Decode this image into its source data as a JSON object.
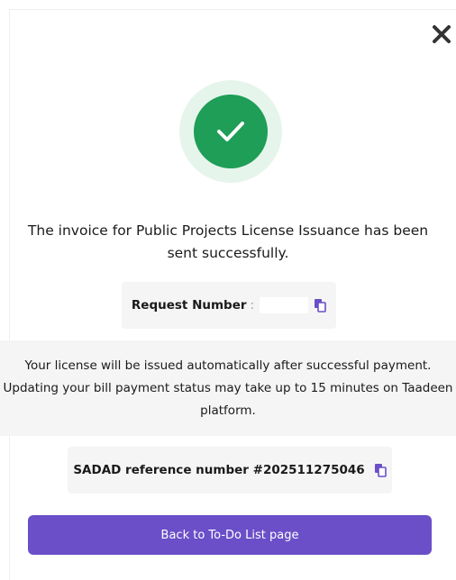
{
  "dialog": {
    "close_icon": "close-icon",
    "status_icon": "check-icon",
    "message": "The invoice for Public Projects License Issuance has been sent successfully.",
    "request": {
      "label": "Request Number",
      "separator": ":",
      "value": "",
      "copy_icon": "copy-icon"
    },
    "info_text": "Your license will be issued automatically after successful payment. Updating your bill payment status may take up to 15 minutes on Taadeen platform.",
    "sadad": {
      "text": "SADAD reference number #202511275046",
      "copy_icon": "copy-icon"
    },
    "back_button_label": "Back to To-Do List page"
  },
  "colors": {
    "success_green": "#1e9e57",
    "success_ring": "#e6f5ec",
    "primary_purple": "#6a4fc8",
    "panel_gray": "#f5f5f5"
  }
}
